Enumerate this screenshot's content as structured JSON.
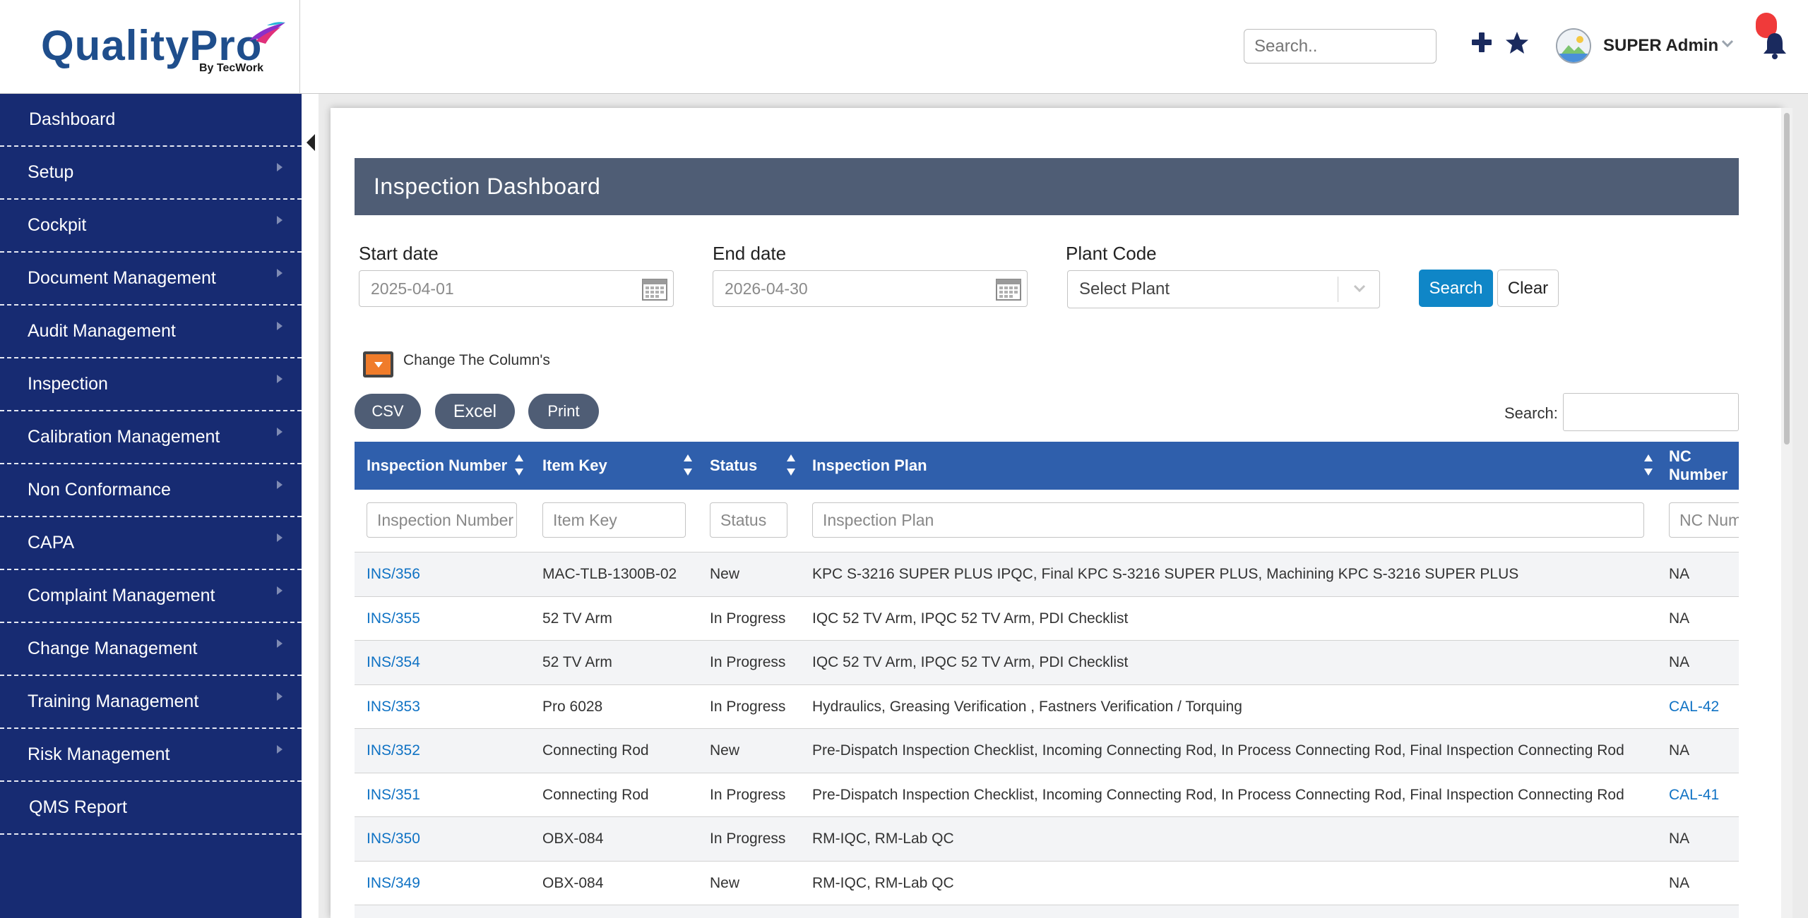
{
  "header": {
    "logo": "QualityPro",
    "logo_tagline": "By TecWork",
    "search_placeholder": "Search..",
    "user_name": "SUPER Admin",
    "icons": [
      "plus-icon",
      "star-icon",
      "avatar",
      "chevron-down-icon",
      "bell-icon"
    ]
  },
  "sidebar": {
    "items": [
      {
        "label": "Dashboard",
        "has_submenu": false
      },
      {
        "label": "Setup",
        "has_submenu": true
      },
      {
        "label": "Cockpit",
        "has_submenu": true
      },
      {
        "label": "Document Management",
        "has_submenu": true
      },
      {
        "label": "Audit Management",
        "has_submenu": true
      },
      {
        "label": "Inspection",
        "has_submenu": true
      },
      {
        "label": "Calibration Management",
        "has_submenu": true
      },
      {
        "label": "Non Conformance",
        "has_submenu": true
      },
      {
        "label": "CAPA",
        "has_submenu": true
      },
      {
        "label": "Complaint Management",
        "has_submenu": true
      },
      {
        "label": "Change Management",
        "has_submenu": true
      },
      {
        "label": "Training Management",
        "has_submenu": true
      },
      {
        "label": "Risk Management",
        "has_submenu": true
      },
      {
        "label": "QMS Report",
        "has_submenu": false
      }
    ]
  },
  "page": {
    "title": "Inspection Dashboard",
    "filters": {
      "start_label": "Start date",
      "start_value": "2025-04-01",
      "end_label": "End date",
      "end_value": "2026-04-30",
      "plant_label": "Plant Code",
      "plant_value": "Select Plant",
      "search_button": "Search",
      "clear_button": "Clear"
    },
    "change_columns_label": "Change The Column's",
    "export_buttons": {
      "csv": "CSV",
      "excel": "Excel",
      "print": "Print"
    },
    "table_search_label": "Search:"
  },
  "table": {
    "columns": [
      "Inspection Number",
      "Item Key",
      "Status",
      "Inspection Plan",
      "NC Number"
    ],
    "filter_placeholders": [
      "Inspection Number",
      "Item Key",
      "Status",
      "Inspection Plan",
      "NC Number"
    ],
    "rows": [
      {
        "number": "INS/356",
        "item": "MAC-TLB-1300B-02",
        "status": "New",
        "plan": "KPC S-3216 SUPER PLUS IPQC, Final KPC S-3216 SUPER PLUS, Machining KPC S-3216 SUPER PLUS",
        "nc": "NA",
        "nc_link": false
      },
      {
        "number": "INS/355",
        "item": "52 TV Arm",
        "status": "In Progress",
        "plan": "IQC 52 TV Arm, IPQC 52 TV Arm, PDI Checklist",
        "nc": "NA",
        "nc_link": false
      },
      {
        "number": "INS/354",
        "item": "52 TV Arm",
        "status": "In Progress",
        "plan": "IQC 52 TV Arm, IPQC 52 TV Arm, PDI Checklist",
        "nc": "NA",
        "nc_link": false
      },
      {
        "number": "INS/353",
        "item": "Pro 6028",
        "status": "In Progress",
        "plan": "Hydraulics, Greasing Verification , Fastners Verification / Torquing",
        "nc": "CAL-42",
        "nc_link": true
      },
      {
        "number": "INS/352",
        "item": "Connecting Rod",
        "status": "New",
        "plan": "Pre-Dispatch Inspection Checklist, Incoming Connecting Rod, In Process Connecting Rod, Final Inspection Connecting Rod",
        "nc": "NA",
        "nc_link": false
      },
      {
        "number": "INS/351",
        "item": "Connecting Rod",
        "status": "In Progress",
        "plan": "Pre-Dispatch Inspection Checklist, Incoming Connecting Rod, In Process Connecting Rod, Final Inspection Connecting Rod",
        "nc": "CAL-41",
        "nc_link": true
      },
      {
        "number": "INS/350",
        "item": "OBX-084",
        "status": "In Progress",
        "plan": "RM-IQC, RM-Lab QC",
        "nc": "NA",
        "nc_link": false
      },
      {
        "number": "INS/349",
        "item": "OBX-084",
        "status": "New",
        "plan": "RM-IQC, RM-Lab QC",
        "nc": "NA",
        "nc_link": false
      },
      {
        "number": "",
        "item": "",
        "status": "",
        "plan": "",
        "nc": "",
        "nc_link": false
      }
    ]
  },
  "colors": {
    "sidebar_bg": "#172b72",
    "title_bar": "#4f5d75",
    "table_header": "#2f5fac",
    "link": "#0f72c4",
    "search_button": "#0f86c7",
    "accent_orange": "#f07c2a",
    "badge_red": "#f03a3a"
  }
}
